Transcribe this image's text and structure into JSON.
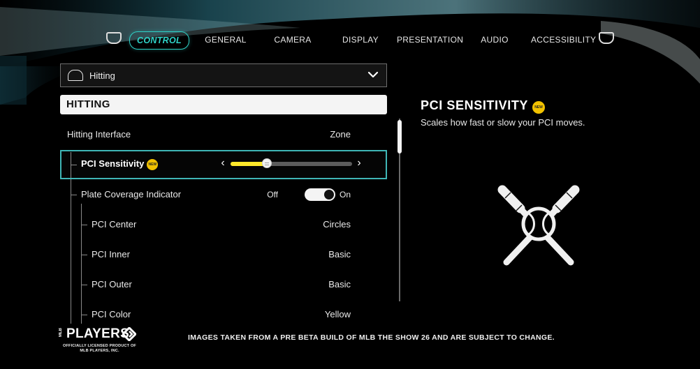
{
  "nav": {
    "tabs": [
      {
        "label": "CONTROL",
        "active": true
      },
      {
        "label": "GENERAL",
        "active": false
      },
      {
        "label": "CAMERA",
        "active": false
      },
      {
        "label": "DISPLAY",
        "active": false
      },
      {
        "label": "PRESENTATION",
        "active": false
      },
      {
        "label": "AUDIO",
        "active": false
      },
      {
        "label": "ACCESSIBILITY",
        "active": false
      }
    ],
    "left_bumper_icon": "left-bumper-icon",
    "right_bumper_icon": "right-bumper-icon",
    "accent_color": "#2fd2c8"
  },
  "category_dropdown": {
    "icon": "home-plate-icon",
    "label": "Hitting",
    "chevron_icon": "chevron-down-icon"
  },
  "section": {
    "title": "HITTING"
  },
  "settings": [
    {
      "label": "Hitting Interface",
      "value": "Zone"
    },
    {
      "label": "PCI Sensitivity",
      "badge": "NEW",
      "slider_value": 0.3,
      "selected": true
    },
    {
      "label": "Plate Coverage Indicator",
      "toggle_off_label": "Off",
      "toggle_on_label": "On",
      "toggle_state": "on"
    },
    {
      "label": "PCI Center",
      "value": "Circles"
    },
    {
      "label": "PCI Inner",
      "value": "Basic"
    },
    {
      "label": "PCI Outer",
      "value": "Basic"
    },
    {
      "label": "PCI Color",
      "value": "Yellow"
    }
  ],
  "slider": {
    "left_arrow": "‹",
    "right_arrow": "›",
    "fill_color": "#ffe82a"
  },
  "info_panel": {
    "title": "PCI SENSITIVITY",
    "badge": "NEW",
    "description": "Scales how fast or slow your PCI moves.",
    "art_icon": "crossed-bats-ball-icon"
  },
  "footer": {
    "logo_mlb": "MLB",
    "logo_word": "PLAYERS",
    "logo_sub_line1": "OFFICIALLY LICENSED PRODUCT OF",
    "logo_sub_line2": "MLB PLAYERS, INC.",
    "disclaimer": "IMAGES TAKEN FROM A PRE BETA BUILD OF MLB THE SHOW 26 AND ARE SUBJECT TO CHANGE."
  },
  "badge_color": "#f2c200",
  "selection_color": "#3fb6b6"
}
